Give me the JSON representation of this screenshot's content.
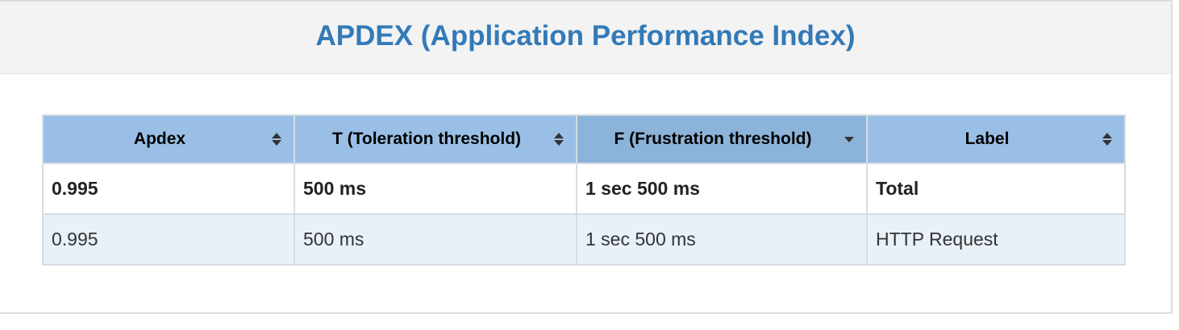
{
  "panel": {
    "title": "APDEX (Application Performance Index)"
  },
  "table": {
    "columns": [
      {
        "label": "Apdex",
        "sort_icon": "sort-both-icon"
      },
      {
        "label": "T (Toleration threshold)",
        "sort_icon": "sort-both-icon"
      },
      {
        "label": "F (Frustration threshold)",
        "sort_icon": "sort-desc-icon"
      },
      {
        "label": "Label",
        "sort_icon": "sort-both-icon"
      }
    ],
    "rows": [
      [
        "0.995",
        "500 ms",
        "1 sec 500 ms",
        "Total"
      ],
      [
        "0.995",
        "500 ms",
        "1 sec 500 ms",
        "HTTP Request"
      ]
    ]
  },
  "colors": {
    "title": "#337ab7",
    "header_bg": "#99bfe6",
    "sorted_header_bg": "#8cb3d9",
    "odd_row_bg": "#e8f0f8"
  }
}
